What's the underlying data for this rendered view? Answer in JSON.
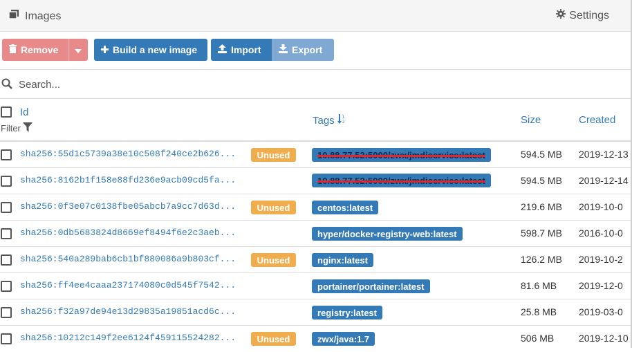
{
  "header": {
    "title": "Images",
    "title_icon": "clone-icon",
    "settings_label": "Settings",
    "settings_icon": "gear-icon"
  },
  "toolbar": {
    "remove_label": "Remove",
    "build_label": "Build a new image",
    "import_label": "Import",
    "export_label": "Export"
  },
  "search": {
    "placeholder": "Search..."
  },
  "table": {
    "headers": {
      "id": "Id",
      "filter": "Filter",
      "tags": "Tags",
      "size": "Size",
      "created": "Created"
    },
    "rows": [
      {
        "id": "sha256:55d1c5739a38e10c508f240ce2b626...",
        "unused": "Unused",
        "tag": "10.88.77.52:5000/zwx/jmdiservice:latest",
        "redacted": true,
        "size": "594.5 MB",
        "created": "2019-12-13"
      },
      {
        "id": "sha256:8162b1f158e88fd236e9acb09cd5fa...",
        "unused": "",
        "tag": "10.88.77.52:5000/zwx/jmdiservice:latest",
        "redacted": true,
        "size": "594.5 MB",
        "created": "2019-12-14"
      },
      {
        "id": "sha256:0f3e07c0138fbe05abcb7a9cc7d63d...",
        "unused": "Unused",
        "tag": "centos:latest",
        "redacted": false,
        "size": "219.6 MB",
        "created": "2019-10-0"
      },
      {
        "id": "sha256:0db5683824d8669ef8494f6e2c3aeb...",
        "unused": "",
        "tag": "hyper/docker-registry-web:latest",
        "redacted": false,
        "size": "598.7 MB",
        "created": "2016-10-0"
      },
      {
        "id": "sha256:540a289bab6cb1bf880086a9b803cf...",
        "unused": "Unused",
        "tag": "nginx:latest",
        "redacted": false,
        "size": "126.2 MB",
        "created": "2019-10-2"
      },
      {
        "id": "sha256:ff4ee4caaa237174080c0d545f7542...",
        "unused": "",
        "tag": "portainer/portainer:latest",
        "redacted": false,
        "size": "81.6 MB",
        "created": "2019-12-0"
      },
      {
        "id": "sha256:f32a97de94e13d29835a19851acd6c...",
        "unused": "",
        "tag": "registry:latest",
        "redacted": false,
        "size": "25.8 MB",
        "created": "2019-03-0"
      },
      {
        "id": "sha256:10212c149f2ee6124f459115524282...",
        "unused": "Unused",
        "tag": "zwx/java:1.7",
        "redacted": false,
        "size": "506 MB",
        "created": "2019-12-10"
      }
    ]
  },
  "colors": {
    "primary": "#337ab7",
    "danger_light": "#e88a8a",
    "warning": "#f0ad4e"
  }
}
